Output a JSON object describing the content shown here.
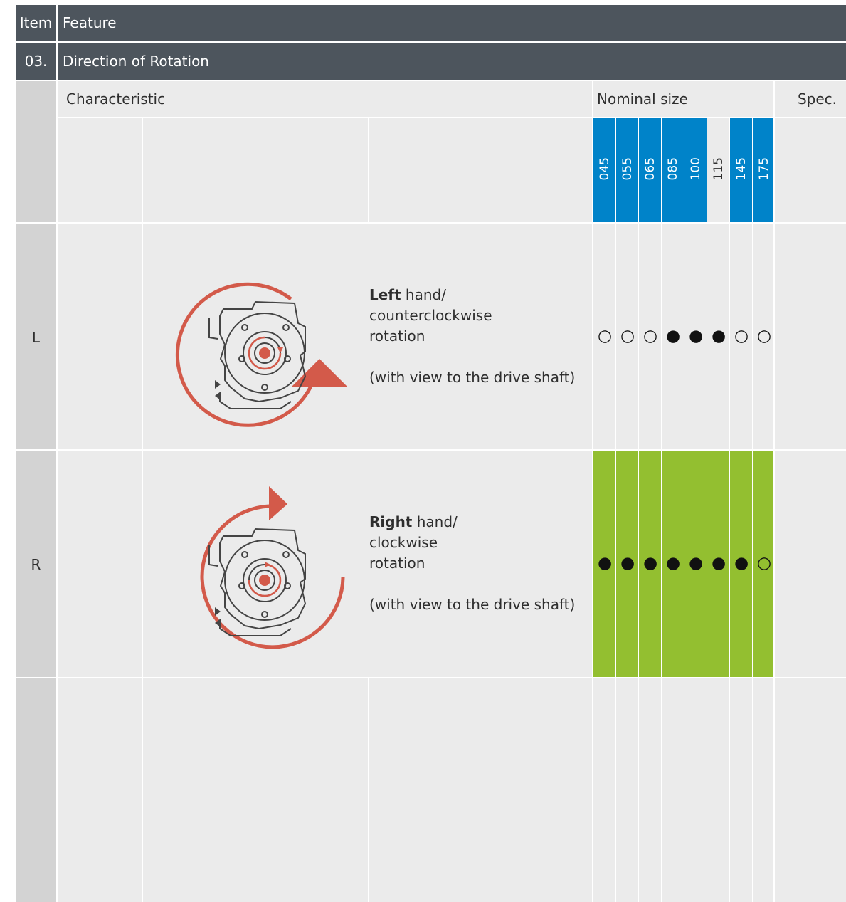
{
  "header": {
    "item_label": "Item",
    "feature_label": "Feature"
  },
  "section": {
    "number": "03.",
    "title": "Direction of Rotation"
  },
  "subheader": {
    "characteristic": "Characteristic",
    "nominal_size": "Nominal size",
    "spec": "Spec."
  },
  "sizes": [
    "045",
    "055",
    "065",
    "085",
    "100",
    "115",
    "145",
    "175"
  ],
  "size_highlight": [
    true,
    true,
    true,
    true,
    true,
    false,
    true,
    true
  ],
  "rows": [
    {
      "code": "L",
      "bold": "Left",
      "line1_rest": " hand/",
      "line2": "counterclockwise",
      "line3": "rotation",
      "note": "(with view to the drive shaft)",
      "availability": [
        "○",
        "○",
        "○",
        "●",
        "●",
        "●",
        "○",
        "○"
      ],
      "highlight": false
    },
    {
      "code": "R",
      "bold": "Right",
      "line1_rest": " hand/",
      "line2": "clockwise",
      "line3": "rotation",
      "note": "(with view to the drive shaft)",
      "availability": [
        "●",
        "●",
        "●",
        "●",
        "●",
        "●",
        "●",
        "○"
      ],
      "highlight": true
    }
  ],
  "colors": {
    "header_bg": "#4d555d",
    "size_blue": "#0083c9",
    "highlight_green": "#93bf30",
    "arrow_red": "#d35a4a",
    "gearbox_stroke": "#444444"
  }
}
